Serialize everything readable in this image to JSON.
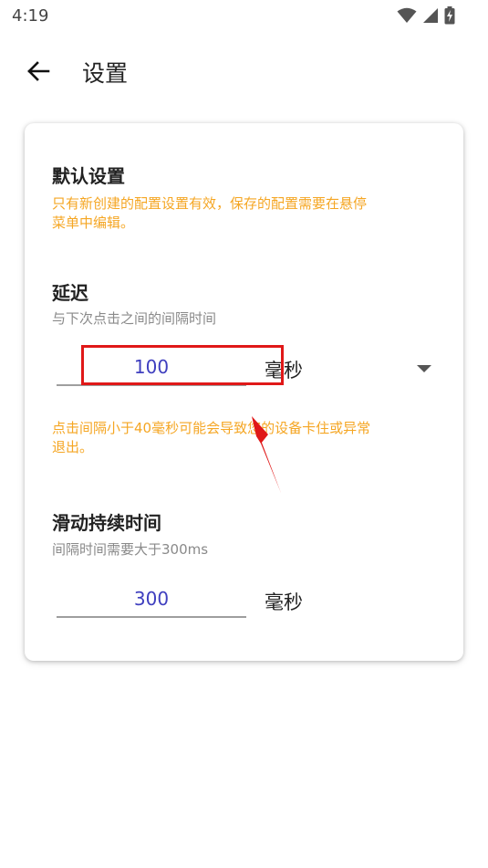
{
  "status_bar": {
    "time": "4:19",
    "icons": [
      "wifi-icon",
      "cellular-signal-icon",
      "battery-charging-icon"
    ]
  },
  "app_bar": {
    "back_icon": "arrow-left-icon",
    "title": "设置"
  },
  "default_settings": {
    "title": "默认设置",
    "notice_line1": "只有新创建的配置设置有效，保存的配置需要在悬停",
    "notice_line2": "菜单中编辑。"
  },
  "delay": {
    "title": "延迟",
    "subtitle": "与下次点击之间的间隔时间",
    "value": "100",
    "unit": "毫秒",
    "dropdown_icon": "caret-down-icon",
    "warning_line1": "点击间隔小于40毫秒可能会导致您的设备卡住或异常",
    "warning_line2": "退出。"
  },
  "swipe_duration": {
    "title": "滑动持续时间",
    "subtitle": "间隔时间需要大于300ms",
    "value": "300",
    "unit": "毫秒"
  },
  "colors": {
    "warning": "#F5A623",
    "input_value": "#3F3FBF",
    "annotation": "#E01818"
  }
}
